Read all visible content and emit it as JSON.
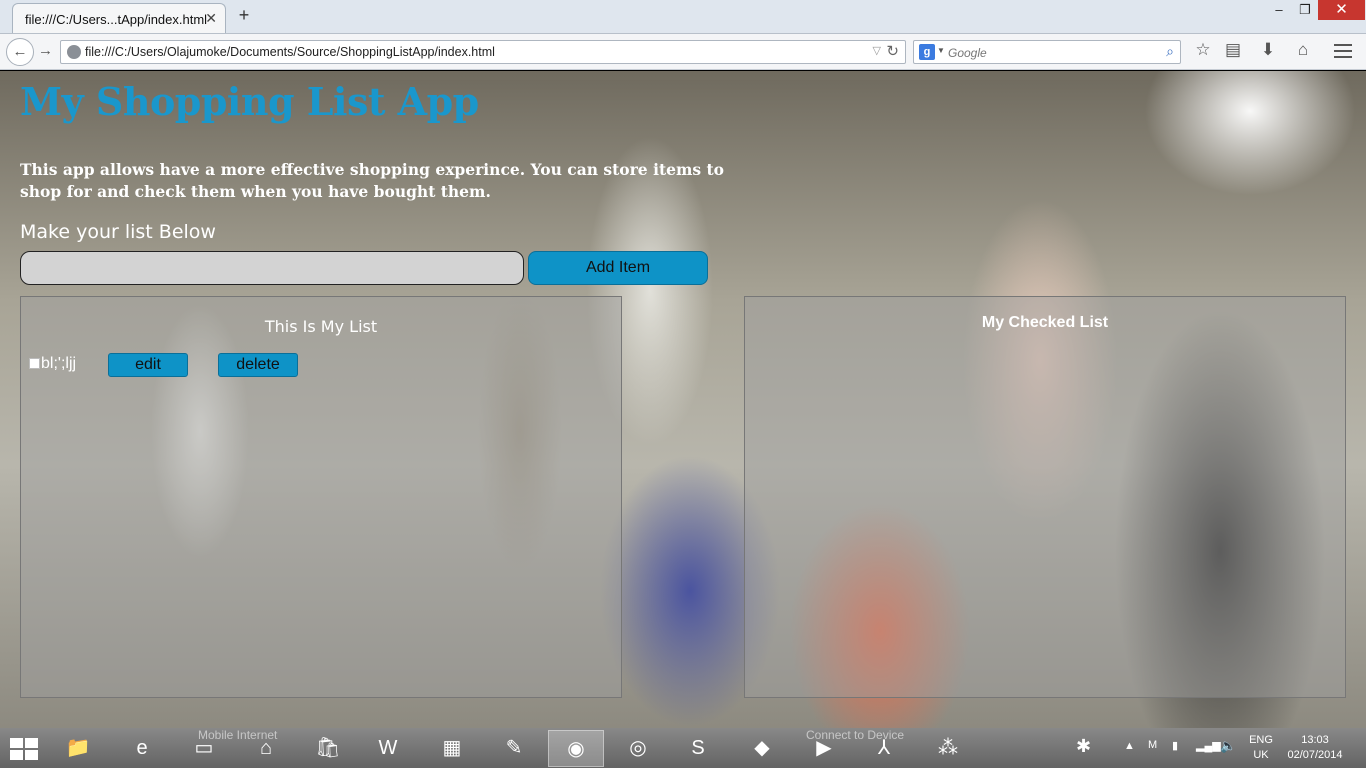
{
  "browser": {
    "tab_title": "file:///C:/Users...tApp/index.html",
    "tab_close": "✕",
    "new_tab": "+",
    "url": "file:///C:/Users/Olajumoke/Documents/Source/ShoppingListApp/index.html",
    "search_placeholder": "Google",
    "search_engine_letter": "g",
    "window_controls": {
      "minimize": "–",
      "maximize": "❐",
      "close": "✕"
    }
  },
  "app": {
    "title": "My Shopping List App",
    "description": "This app allows have a more effective shopping experince. You can store items to shop for and check them when you have bought them.",
    "make_list_label": "Make your list Below",
    "input_value": "",
    "add_button": "Add Item",
    "my_list": {
      "title": "This Is My List",
      "items": [
        {
          "text": "bl;';ljj",
          "checked": false,
          "edit_label": "edit",
          "delete_label": "delete"
        }
      ]
    },
    "checked_list": {
      "title": "My Checked List",
      "items": []
    }
  },
  "taskbar": {
    "ghost_text_left": "Mobile Internet",
    "ghost_text_right": "Connect to Device",
    "apps": [
      "file-explorer",
      "internet-explorer",
      "lenovo",
      "home",
      "store-bag",
      "word",
      "windows-store",
      "paint-tool",
      "firefox",
      "chrome",
      "sublime-text",
      "git",
      "media-player",
      "acrobat",
      "blackberry"
    ],
    "language": "ENG",
    "region": "UK",
    "time": "13:03",
    "date": "02/07/2014",
    "colors": {
      "accent": "#0e93c7",
      "title": "#1a97cc",
      "close_button": "#c7362f"
    }
  }
}
